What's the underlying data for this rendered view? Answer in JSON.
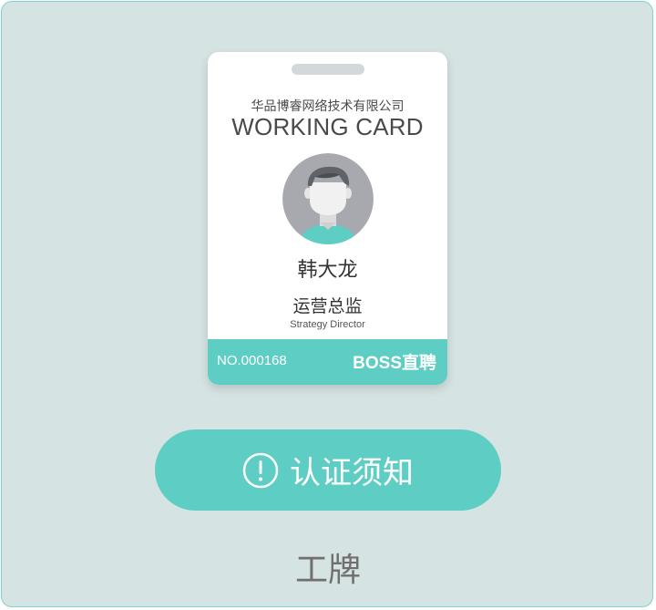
{
  "card": {
    "company": "华品博睿网络技术有限公司",
    "title": "WORKING CARD",
    "name": "韩大龙",
    "role": "运营总监",
    "role_en": "Strategy Director",
    "number": "NO.000168",
    "brand": "BOSS直聘",
    "avatar_icon": "person-avatar-icon"
  },
  "button": {
    "label": "认证须知",
    "icon": "exclamation-circle-icon"
  },
  "caption": "工牌",
  "colors": {
    "accent": "#5ecdc3",
    "background": "#d5e3e2",
    "border": "#7fd3cc",
    "card": "#ffffff"
  }
}
